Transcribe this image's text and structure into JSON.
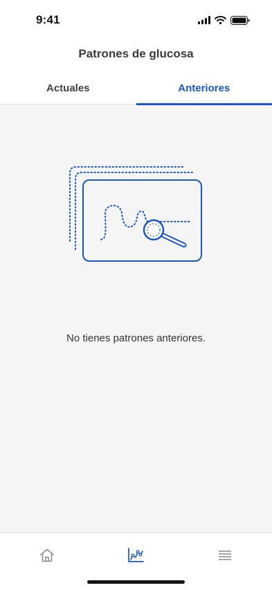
{
  "status_bar": {
    "time": "9:41"
  },
  "header": {
    "title": "Patrones de glucosa"
  },
  "tabs": [
    {
      "label": "Actuales",
      "active": false
    },
    {
      "label": "Anteriores",
      "active": true
    }
  ],
  "empty_state": {
    "message": "No tienes patrones anteriores."
  },
  "bottom_nav": {
    "items": [
      {
        "icon": "home-icon",
        "active": false
      },
      {
        "icon": "chart-icon",
        "active": true
      },
      {
        "icon": "menu-icon",
        "active": false
      }
    ]
  },
  "colors": {
    "accent": "#1a56c9",
    "inactive": "#8a8a8a",
    "background": "#f5f5f5"
  }
}
